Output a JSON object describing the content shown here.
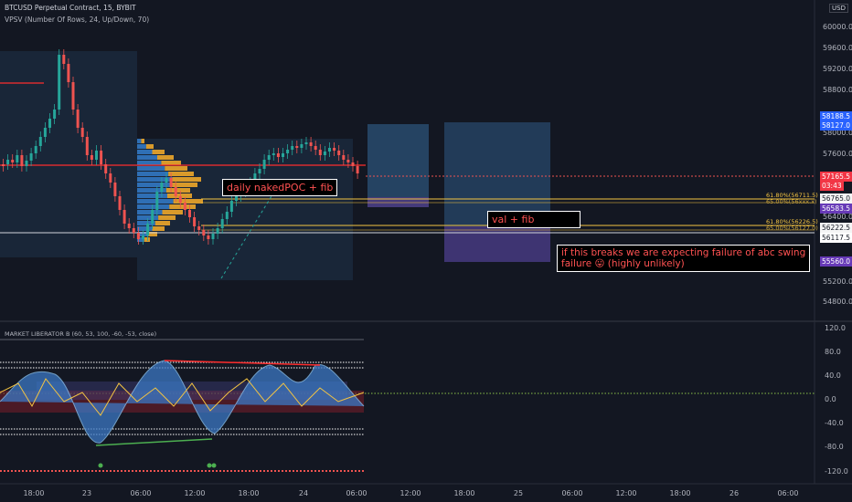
{
  "header": {
    "symbol": "BTCUSD Perpetual Contract, 15, BYBIT",
    "indicator": "VPSV (Number Of Rows, 24, Up/Down, 70)",
    "osc_title": "MARKET LIBERATOR B (60, 53, 100, -60, -53, close)",
    "currency": "USD"
  },
  "price_axis": {
    "ticks": [
      "60000.0",
      "59600.0",
      "59200.0",
      "58800.0",
      "58000.0",
      "57600.0",
      "56400.0",
      "55200.0",
      "54800.0"
    ],
    "tags": [
      {
        "text": "58188.5",
        "color": "#2962ff"
      },
      {
        "text": "58127.0",
        "color": "#2962ff"
      },
      {
        "text": "57165.5",
        "color": "#f23645"
      },
      {
        "text": "03:43",
        "color": "#f23645"
      },
      {
        "text": "56765.0",
        "color": "#f5f5f5"
      },
      {
        "text": "56583.5",
        "color": "#673ab7"
      },
      {
        "text": "56222.5",
        "color": "#f5f5f5"
      },
      {
        "text": "56117.5",
        "color": "#ffffff"
      },
      {
        "text": "55560.0",
        "color": "#673ab7"
      }
    ]
  },
  "osc_axis": {
    "ticks": [
      "120.0",
      "80.0",
      "40.0",
      "0.0",
      "-40.0",
      "-80.0",
      "-120.0"
    ]
  },
  "time_axis": {
    "ticks": [
      "18:00",
      "23",
      "06:00",
      "12:00",
      "18:00",
      "24",
      "06:00",
      "12:00",
      "18:00",
      "25",
      "06:00",
      "12:00",
      "18:00",
      "26",
      "06:00"
    ]
  },
  "annotations": {
    "daily_poc": "daily nakedPOC + fib",
    "val": "val + fib",
    "breaks": "if this breaks we are expecting failure of abc swing\nfailure 😛 (highly unlikely)"
  },
  "fib_labels": {
    "fib1_top": "61.80%(56711.5)",
    "fib1_bottom": "65.00%(56xxx.x)",
    "fib2_top": "61.80%(56226.5)",
    "fib2_bottom": "65.00%(56127.0)"
  },
  "colors": {
    "background": "#131722",
    "bull": "#26a69a",
    "bear": "#ef5350",
    "accent": "#2962ff",
    "fib": "#f5c542",
    "poc": "#ff2d2d"
  }
}
